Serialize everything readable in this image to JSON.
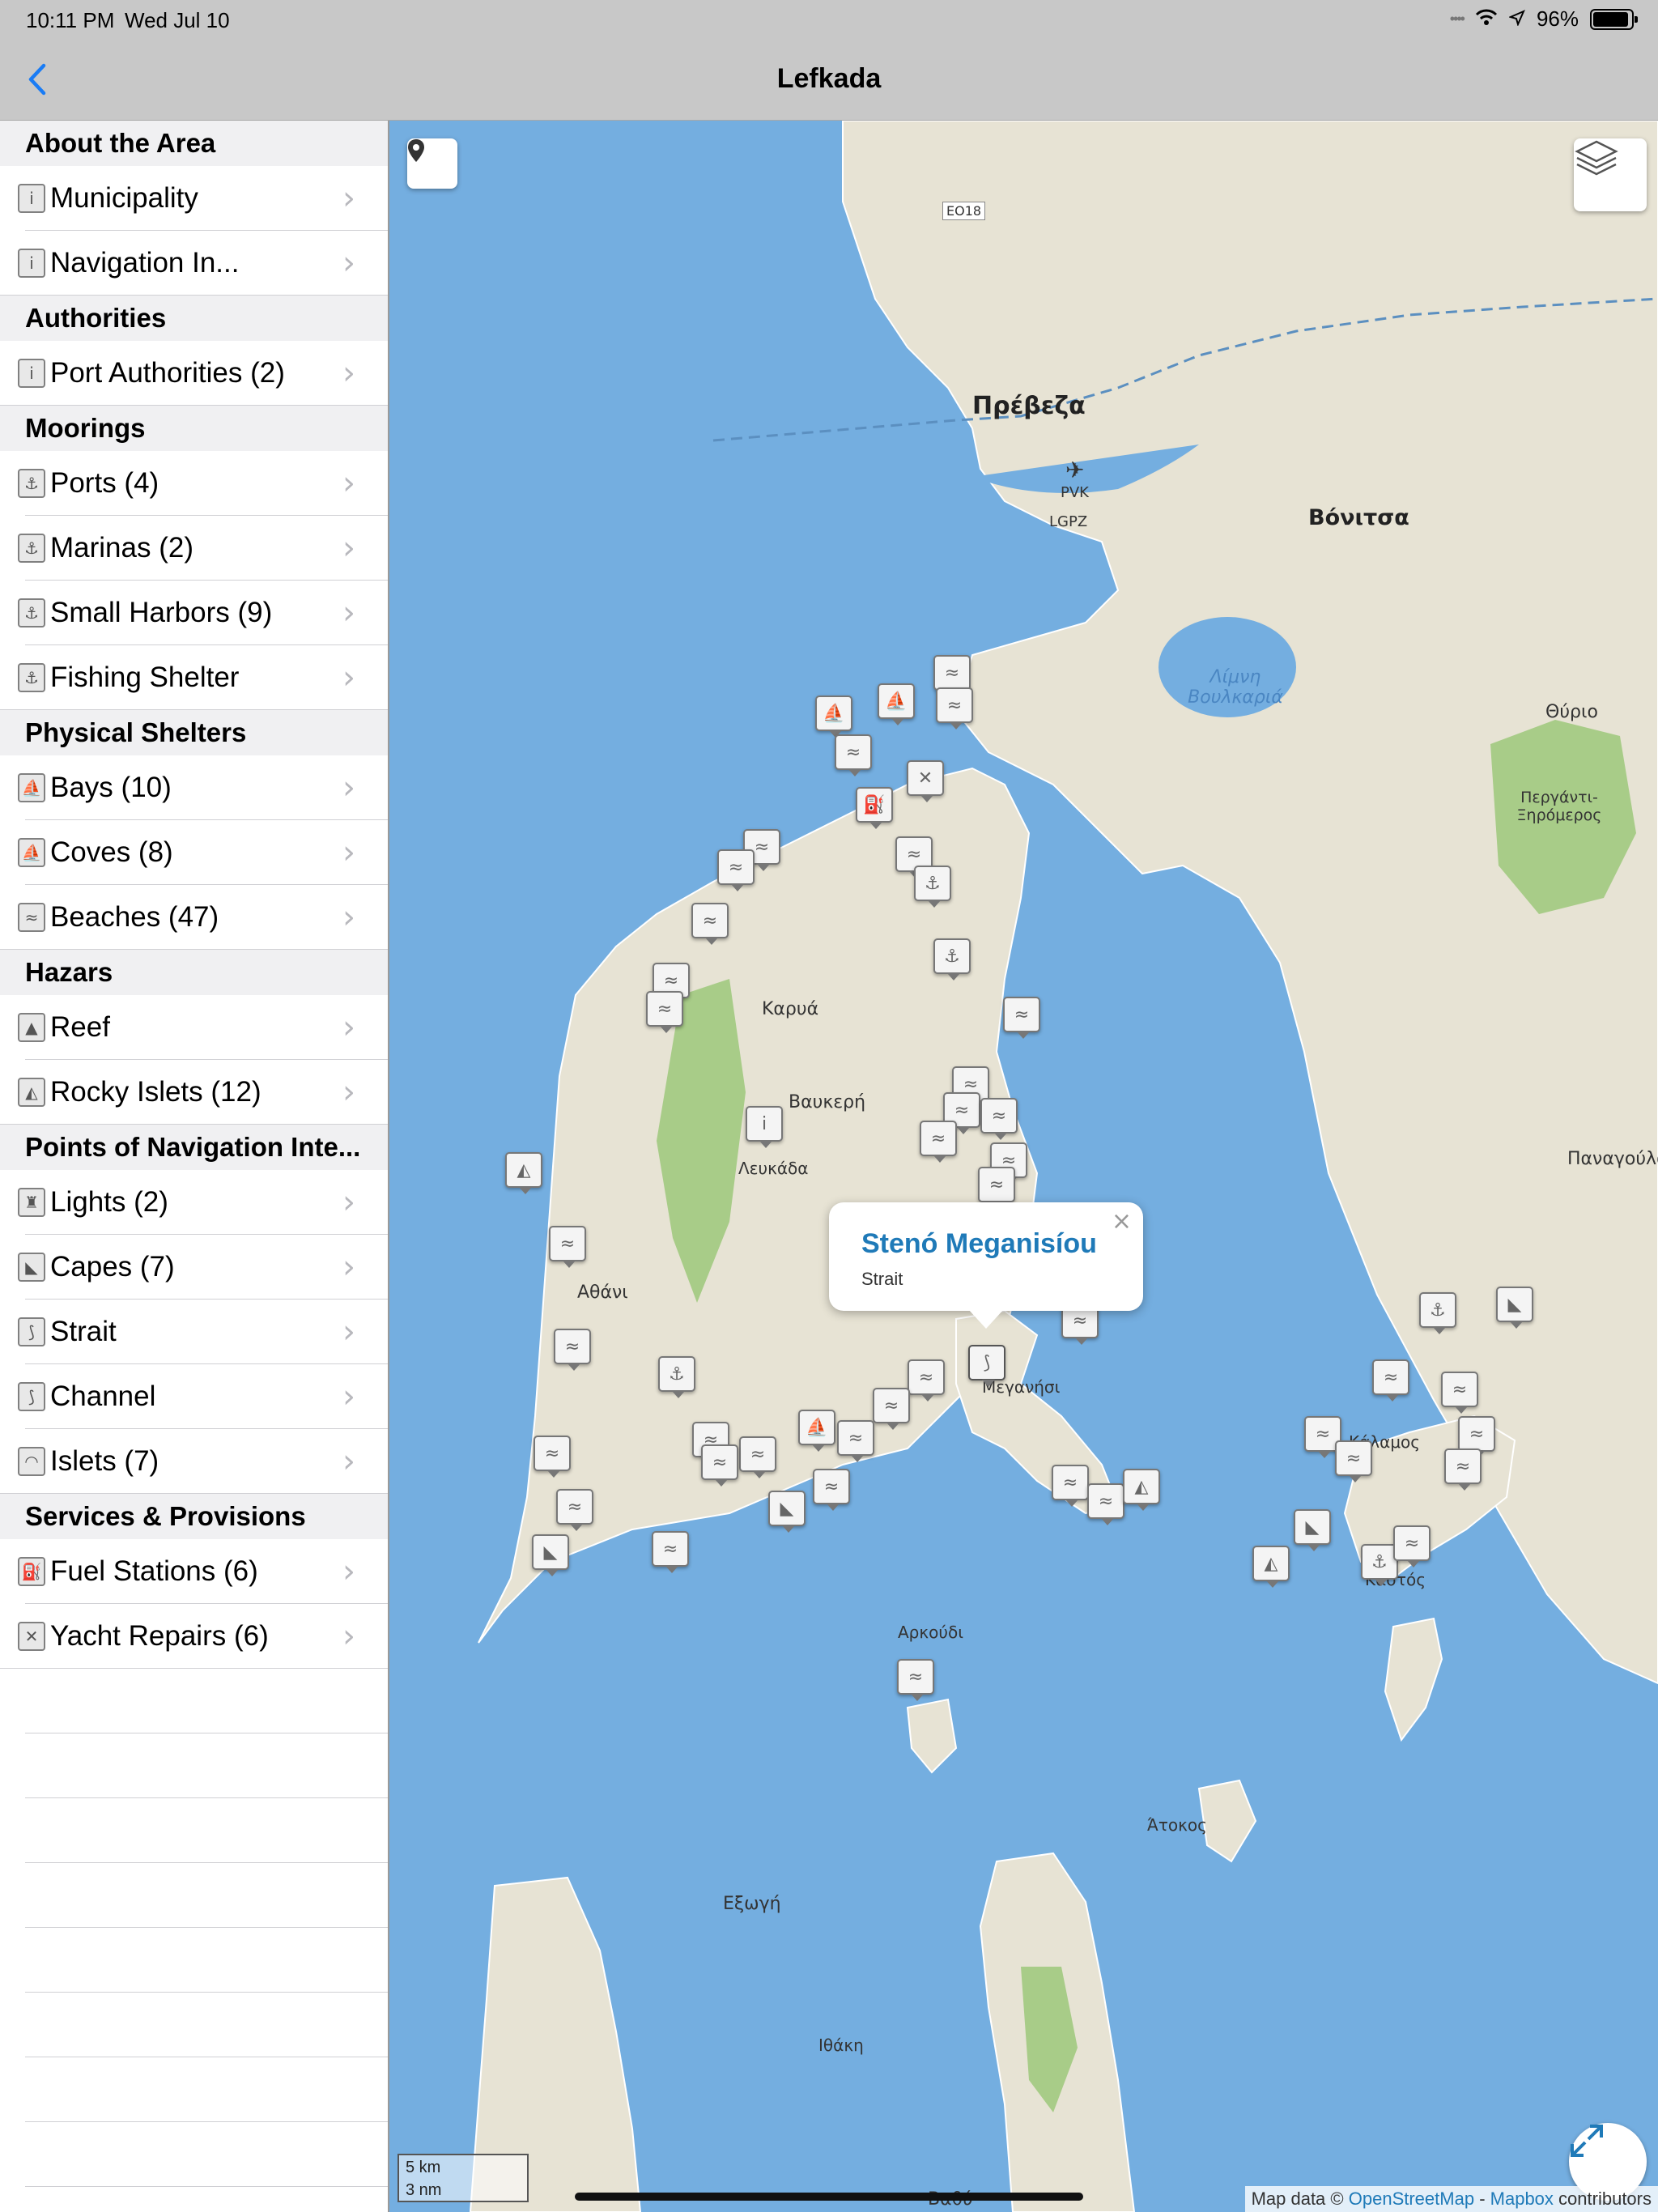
{
  "status_bar": {
    "time": "10:11 PM",
    "date": "Wed Jul 10",
    "battery": "96%",
    "battery_level": 0.96
  },
  "nav": {
    "title": "Lefkada",
    "back_icon": "chevron-left-icon"
  },
  "sidebar": {
    "sections": [
      {
        "header": "About the Area",
        "items": [
          {
            "label": "Municipality",
            "icon": "info-icon"
          },
          {
            "label": "Navigation In...",
            "icon": "info-icon"
          }
        ]
      },
      {
        "header": "Authorities",
        "items": [
          {
            "label": "Port Authorities (2)",
            "icon": "info-icon"
          }
        ]
      },
      {
        "header": "Moorings",
        "items": [
          {
            "label": "Ports (4)",
            "icon": "anchor-icon"
          },
          {
            "label": "Marinas (2)",
            "icon": "anchor-icon"
          },
          {
            "label": "Small Harbors (9)",
            "icon": "anchor-icon"
          },
          {
            "label": "Fishing Shelter",
            "icon": "anchor-icon"
          }
        ]
      },
      {
        "header": "Physical Shelters",
        "items": [
          {
            "label": "Bays (10)",
            "icon": "sailboat-icon"
          },
          {
            "label": "Coves (8)",
            "icon": "sailboat-icon"
          },
          {
            "label": "Beaches (47)",
            "icon": "beach-icon"
          }
        ]
      },
      {
        "header": "Hazars",
        "items": [
          {
            "label": "Reef",
            "icon": "warning-icon"
          },
          {
            "label": "Rocky Islets (12)",
            "icon": "rocks-icon"
          }
        ]
      },
      {
        "header": "Points of Navigation Inte...",
        "items": [
          {
            "label": "Lights (2)",
            "icon": "lighthouse-icon"
          },
          {
            "label": "Capes (7)",
            "icon": "cape-icon"
          },
          {
            "label": "Strait",
            "icon": "strait-icon"
          },
          {
            "label": "Channel",
            "icon": "channel-icon"
          },
          {
            "label": "Islets (7)",
            "icon": "islet-icon"
          }
        ]
      },
      {
        "header": "Services & Provisions",
        "items": [
          {
            "label": "Fuel Stations (6)",
            "icon": "fuel-icon"
          },
          {
            "label": "Yacht Repairs (6)",
            "icon": "wrench-icon"
          }
        ]
      }
    ]
  },
  "map": {
    "places": {
      "preveza": "Πρέβεζα",
      "vonitsa": "Βόνιτσα",
      "thyrio": "Θύριο",
      "vulkaria": "Λίμνη Βουλκαριά",
      "perganti": "Περγάντι-Ξηρόμερος",
      "karya": "Καρυά",
      "vafkeri": "Βαυκερή",
      "lefkada": "Λευκάδα",
      "athani": "Αθάνι",
      "meganisi": "Μεγανήσι",
      "arkoudi": "Αρκούδι",
      "atokos": "Άτοκος",
      "exogi": "Εξωγή",
      "ithaki": "Ιθάκη",
      "panagoula": "Παναγούλα",
      "kalamos": "Κάλαμος",
      "kastos": "Καστός",
      "vathi": "Βαθύ",
      "pvk": "PVK",
      "lgpz": "LGPZ",
      "eo18": "EO18"
    },
    "popup": {
      "title": "Stenó Meganisíou",
      "subtitle": "Strait",
      "close": "×"
    },
    "scale": {
      "km": "5 km",
      "nm": "3 nm"
    },
    "attribution": {
      "prefix": "Map data ©",
      "osm": "OpenStreetMap",
      "sep": "-",
      "mapbox": "Mapbox",
      "suffix": "contributors"
    },
    "colors": {
      "water": "#74aee0",
      "land": "#e7e3d4",
      "forest": "#a8cc88",
      "link": "#1f7ab8"
    }
  }
}
